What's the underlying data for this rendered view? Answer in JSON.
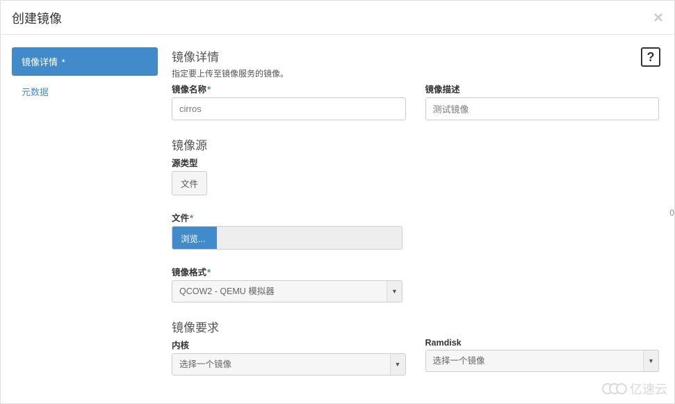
{
  "modal": {
    "title": "创建镜像",
    "close_glyph": "×"
  },
  "side": {
    "tabs": [
      {
        "label": "镜像详情",
        "required_mark": "*"
      },
      {
        "label": "元数据"
      }
    ]
  },
  "help_glyph": "?",
  "details": {
    "section_title": "镜像详情",
    "description": "指定要上传至镜像服务的镜像。",
    "name": {
      "label": "镜像名称",
      "required_mark": "*",
      "value": "cirros"
    },
    "desc": {
      "label": "镜像描述",
      "value": "测试镜像"
    }
  },
  "source": {
    "section_title": "镜像源",
    "type": {
      "label": "源类型",
      "button": "文件"
    },
    "file": {
      "label": "文件",
      "required_mark": "*",
      "browse": "浏览..."
    },
    "format": {
      "label": "镜像格式",
      "required_mark": "*",
      "selected": "QCOW2 - QEMU 模拟器"
    }
  },
  "reqs": {
    "section_title": "镜像要求",
    "kernel": {
      "label": "内核",
      "placeholder": "选择一个镜像"
    },
    "ramdisk": {
      "label": "Ramdisk",
      "placeholder": "选择一个镜像"
    }
  },
  "watermark": "亿速云",
  "edge_value": "0",
  "arrow_glyph": "▼"
}
